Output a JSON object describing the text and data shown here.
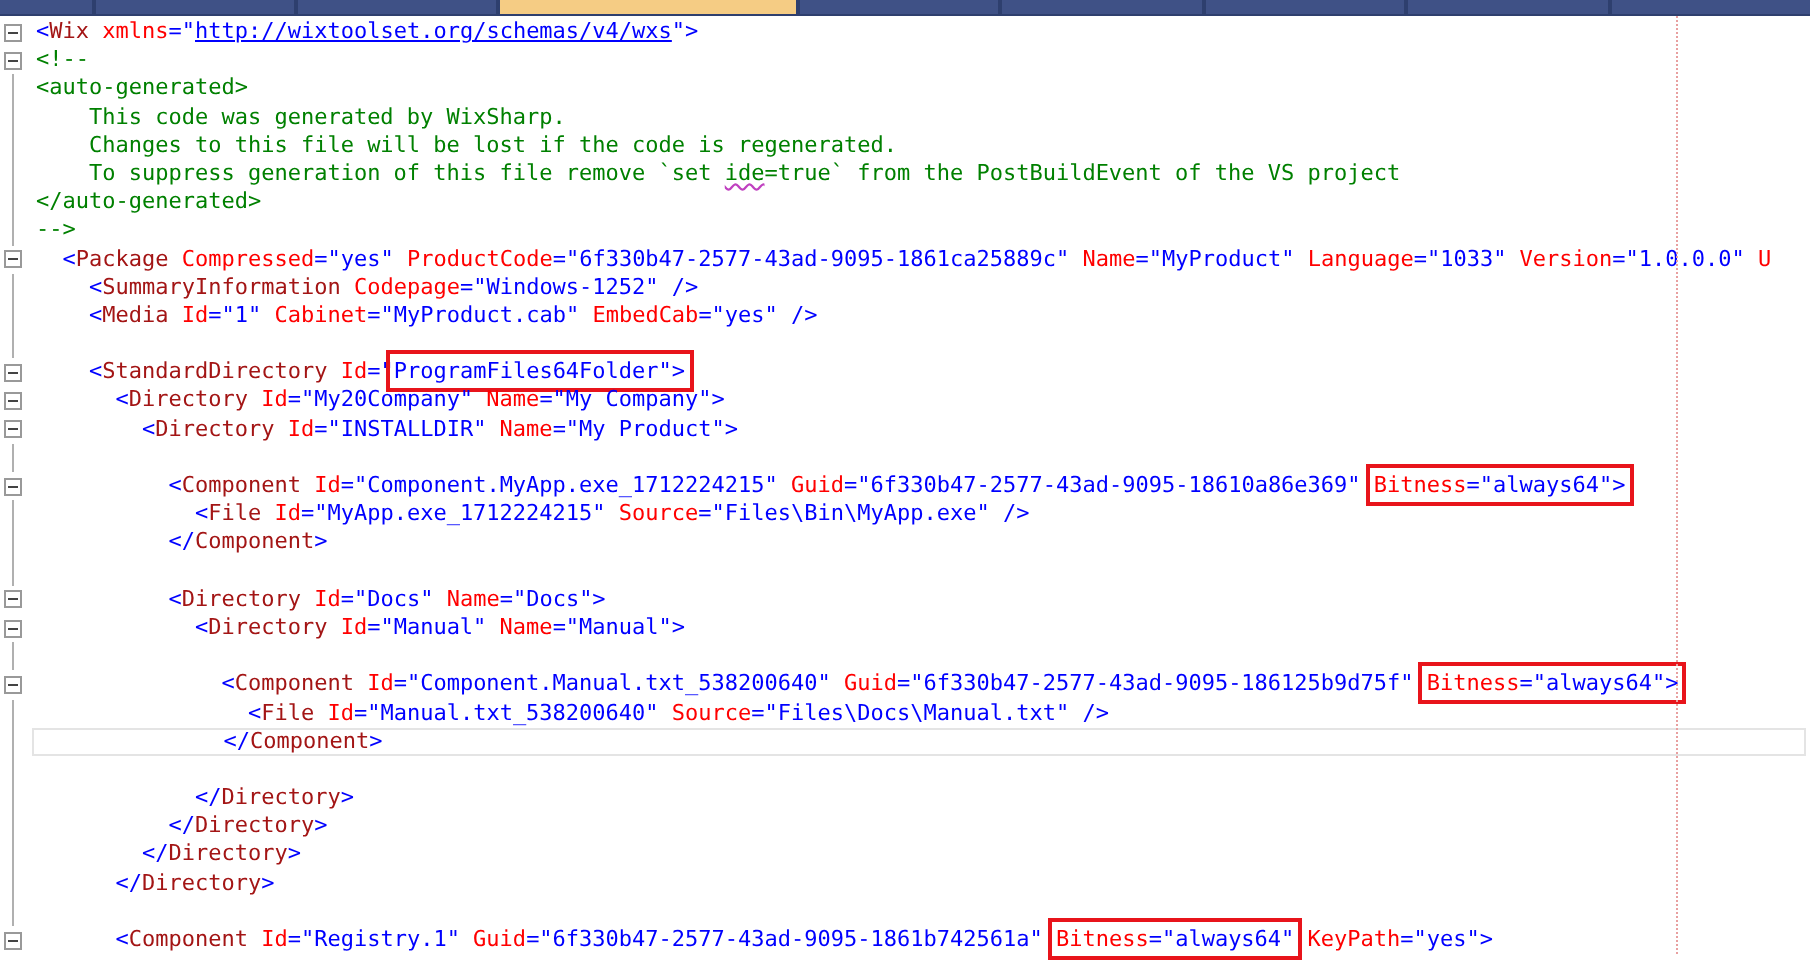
{
  "tabs": [
    {
      "selected": false
    },
    {
      "selected": false
    },
    {
      "selected": false
    },
    {
      "selected": true
    },
    {
      "selected": false
    },
    {
      "selected": false
    },
    {
      "selected": false
    },
    {
      "selected": false
    },
    {
      "selected": false
    }
  ],
  "lines": [
    {
      "fold": true,
      "current": false,
      "parts": [
        {
          "boxed": false,
          "tokens": [
            {
              "kind": "punct",
              "text": "<"
            },
            {
              "kind": "tag",
              "text": "Wix"
            },
            {
              "kind": "attr",
              "text": " xmlns"
            },
            {
              "kind": "punct",
              "text": "=\""
            },
            {
              "kind": "link",
              "text": "http://wixtoolset.org/schemas/v4/wxs"
            },
            {
              "kind": "punct",
              "text": "\">"
            }
          ]
        }
      ]
    },
    {
      "fold": true,
      "current": false,
      "parts": [
        {
          "boxed": false,
          "tokens": [
            {
              "kind": "comment",
              "text": "<!--"
            }
          ]
        }
      ]
    },
    {
      "fold": false,
      "current": false,
      "parts": [
        {
          "boxed": false,
          "tokens": [
            {
              "kind": "comment",
              "text": "<auto-generated>"
            }
          ]
        }
      ]
    },
    {
      "fold": false,
      "current": false,
      "parts": [
        {
          "boxed": false,
          "tokens": [
            {
              "kind": "comment",
              "text": "    This code was generated by WixSharp."
            }
          ]
        }
      ]
    },
    {
      "fold": false,
      "current": false,
      "parts": [
        {
          "boxed": false,
          "tokens": [
            {
              "kind": "comment",
              "text": "    Changes to this file will be lost if the code is regenerated."
            }
          ]
        }
      ]
    },
    {
      "fold": false,
      "current": false,
      "parts": [
        {
          "boxed": false,
          "tokens": [
            {
              "kind": "comment",
              "text": "    To suppress generation of this file remove `set "
            },
            {
              "kind": "misspelled",
              "text": "ide"
            },
            {
              "kind": "comment",
              "text": "=true` from the PostBuildEvent of the VS project"
            }
          ]
        }
      ]
    },
    {
      "fold": false,
      "current": false,
      "parts": [
        {
          "boxed": false,
          "tokens": [
            {
              "kind": "comment",
              "text": "</auto-generated>"
            }
          ]
        }
      ]
    },
    {
      "fold": false,
      "current": false,
      "parts": [
        {
          "boxed": false,
          "tokens": [
            {
              "kind": "comment",
              "text": "-->"
            }
          ]
        }
      ]
    },
    {
      "fold": true,
      "current": false,
      "parts": [
        {
          "boxed": false,
          "tokens": [
            {
              "kind": "punct",
              "text": "  <"
            },
            {
              "kind": "tag",
              "text": "Package"
            },
            {
              "kind": "attr",
              "text": " Compressed"
            },
            {
              "kind": "punct",
              "text": "=\"yes\""
            },
            {
              "kind": "attr",
              "text": " ProductCode"
            },
            {
              "kind": "punct",
              "text": "=\"6f330b47-2577-43ad-9095-1861ca25889c\""
            },
            {
              "kind": "attr",
              "text": " Name"
            },
            {
              "kind": "punct",
              "text": "=\"MyProduct\""
            },
            {
              "kind": "attr",
              "text": " Language"
            },
            {
              "kind": "punct",
              "text": "=\"1033\""
            },
            {
              "kind": "attr",
              "text": " Version"
            },
            {
              "kind": "punct",
              "text": "=\"1.0.0.0\""
            },
            {
              "kind": "attr",
              "text": " U"
            }
          ]
        }
      ]
    },
    {
      "fold": false,
      "current": false,
      "parts": [
        {
          "boxed": false,
          "tokens": [
            {
              "kind": "punct",
              "text": "    <"
            },
            {
              "kind": "tag",
              "text": "SummaryInformation"
            },
            {
              "kind": "attr",
              "text": " Codepage"
            },
            {
              "kind": "punct",
              "text": "=\"Windows-1252\" />"
            }
          ]
        }
      ]
    },
    {
      "fold": false,
      "current": false,
      "parts": [
        {
          "boxed": false,
          "tokens": [
            {
              "kind": "punct",
              "text": "    <"
            },
            {
              "kind": "tag",
              "text": "Media"
            },
            {
              "kind": "attr",
              "text": " Id"
            },
            {
              "kind": "punct",
              "text": "=\"1\""
            },
            {
              "kind": "attr",
              "text": " Cabinet"
            },
            {
              "kind": "punct",
              "text": "=\"MyProduct.cab\""
            },
            {
              "kind": "attr",
              "text": " EmbedCab"
            },
            {
              "kind": "punct",
              "text": "=\"yes\" />"
            }
          ]
        }
      ]
    },
    {
      "fold": false,
      "current": false
    },
    {
      "fold": true,
      "current": false,
      "parts": [
        {
          "boxed": false,
          "tokens": [
            {
              "kind": "punct",
              "text": "    <"
            },
            {
              "kind": "tag",
              "text": "StandardDirectory"
            },
            {
              "kind": "attr",
              "text": " Id"
            },
            {
              "kind": "punct",
              "text": "=\""
            }
          ]
        },
        {
          "boxed": true,
          "tokens": [
            {
              "kind": "punct",
              "text": "ProgramFiles64Folder\">"
            }
          ]
        }
      ]
    },
    {
      "fold": true,
      "current": false,
      "parts": [
        {
          "boxed": false,
          "tokens": [
            {
              "kind": "punct",
              "text": "      <"
            },
            {
              "kind": "tag",
              "text": "Directory"
            },
            {
              "kind": "attr",
              "text": " Id"
            },
            {
              "kind": "punct",
              "text": "=\"My20Company\""
            },
            {
              "kind": "attr",
              "text": " Name"
            },
            {
              "kind": "punct",
              "text": "=\"My Company\">"
            }
          ]
        }
      ]
    },
    {
      "fold": true,
      "current": false,
      "parts": [
        {
          "boxed": false,
          "tokens": [
            {
              "kind": "punct",
              "text": "        <"
            },
            {
              "kind": "tag",
              "text": "Directory"
            },
            {
              "kind": "attr",
              "text": " Id"
            },
            {
              "kind": "punct",
              "text": "=\"INSTALLDIR\""
            },
            {
              "kind": "attr",
              "text": " Name"
            },
            {
              "kind": "punct",
              "text": "=\"My Product\">"
            }
          ]
        }
      ]
    },
    {
      "fold": false,
      "current": false
    },
    {
      "fold": true,
      "current": false,
      "parts": [
        {
          "boxed": false,
          "tokens": [
            {
              "kind": "punct",
              "text": "          <"
            },
            {
              "kind": "tag",
              "text": "Component"
            },
            {
              "kind": "attr",
              "text": " Id"
            },
            {
              "kind": "punct",
              "text": "=\"Component.MyApp.exe_1712224215\""
            },
            {
              "kind": "attr",
              "text": " Guid"
            },
            {
              "kind": "punct",
              "text": "=\"6f330b47-2577-43ad-9095-18610a86e369\" "
            }
          ]
        },
        {
          "boxed": true,
          "tokens": [
            {
              "kind": "attr",
              "text": "Bitness"
            },
            {
              "kind": "punct",
              "text": "=\"always64\">"
            }
          ]
        }
      ]
    },
    {
      "fold": false,
      "current": false,
      "parts": [
        {
          "boxed": false,
          "tokens": [
            {
              "kind": "punct",
              "text": "            <"
            },
            {
              "kind": "tag",
              "text": "File"
            },
            {
              "kind": "attr",
              "text": " Id"
            },
            {
              "kind": "punct",
              "text": "=\"MyApp.exe_1712224215\""
            },
            {
              "kind": "attr",
              "text": " Source"
            },
            {
              "kind": "punct",
              "text": "=\"Files\\Bin\\MyApp.exe\" />"
            }
          ]
        }
      ]
    },
    {
      "fold": false,
      "current": false,
      "parts": [
        {
          "boxed": false,
          "tokens": [
            {
              "kind": "punct",
              "text": "          </"
            },
            {
              "kind": "tag",
              "text": "Component"
            },
            {
              "kind": "punct",
              "text": ">"
            }
          ]
        }
      ]
    },
    {
      "fold": false,
      "current": false
    },
    {
      "fold": true,
      "current": false,
      "parts": [
        {
          "boxed": false,
          "tokens": [
            {
              "kind": "punct",
              "text": "          <"
            },
            {
              "kind": "tag",
              "text": "Directory"
            },
            {
              "kind": "attr",
              "text": " Id"
            },
            {
              "kind": "punct",
              "text": "=\"Docs\""
            },
            {
              "kind": "attr",
              "text": " Name"
            },
            {
              "kind": "punct",
              "text": "=\"Docs\">"
            }
          ]
        }
      ]
    },
    {
      "fold": true,
      "current": false,
      "parts": [
        {
          "boxed": false,
          "tokens": [
            {
              "kind": "punct",
              "text": "            <"
            },
            {
              "kind": "tag",
              "text": "Directory"
            },
            {
              "kind": "attr",
              "text": " Id"
            },
            {
              "kind": "punct",
              "text": "=\"Manual\""
            },
            {
              "kind": "attr",
              "text": " Name"
            },
            {
              "kind": "punct",
              "text": "=\"Manual\">"
            }
          ]
        }
      ]
    },
    {
      "fold": false,
      "current": false
    },
    {
      "fold": true,
      "current": false,
      "parts": [
        {
          "boxed": false,
          "tokens": [
            {
              "kind": "punct",
              "text": "              <"
            },
            {
              "kind": "tag",
              "text": "Component"
            },
            {
              "kind": "attr",
              "text": " Id"
            },
            {
              "kind": "punct",
              "text": "=\"Component.Manual.txt_538200640\""
            },
            {
              "kind": "attr",
              "text": " Guid"
            },
            {
              "kind": "punct",
              "text": "=\"6f330b47-2577-43ad-9095-186125b9d75f\" "
            }
          ]
        },
        {
          "boxed": true,
          "tokens": [
            {
              "kind": "attr",
              "text": "Bitness"
            },
            {
              "kind": "punct",
              "text": "=\"always64\">"
            }
          ]
        }
      ]
    },
    {
      "fold": false,
      "current": false,
      "parts": [
        {
          "boxed": false,
          "tokens": [
            {
              "kind": "punct",
              "text": "                <"
            },
            {
              "kind": "tag",
              "text": "File"
            },
            {
              "kind": "attr",
              "text": " Id"
            },
            {
              "kind": "punct",
              "text": "=\"Manual.txt_538200640\""
            },
            {
              "kind": "attr",
              "text": " Source"
            },
            {
              "kind": "punct",
              "text": "=\"Files\\Docs\\Manual.txt\" />"
            }
          ]
        }
      ]
    },
    {
      "fold": false,
      "current": true,
      "parts": [
        {
          "boxed": false,
          "tokens": [
            {
              "kind": "punct",
              "text": "              </"
            },
            {
              "kind": "tag",
              "text": "Component"
            },
            {
              "kind": "punct",
              "text": ">"
            }
          ]
        }
      ]
    },
    {
      "fold": false,
      "current": false
    },
    {
      "fold": false,
      "current": false,
      "parts": [
        {
          "boxed": false,
          "tokens": [
            {
              "kind": "punct",
              "text": "            </"
            },
            {
              "kind": "tag",
              "text": "Directory"
            },
            {
              "kind": "punct",
              "text": ">"
            }
          ]
        }
      ]
    },
    {
      "fold": false,
      "current": false,
      "parts": [
        {
          "boxed": false,
          "tokens": [
            {
              "kind": "punct",
              "text": "          </"
            },
            {
              "kind": "tag",
              "text": "Directory"
            },
            {
              "kind": "punct",
              "text": ">"
            }
          ]
        }
      ]
    },
    {
      "fold": false,
      "current": false,
      "parts": [
        {
          "boxed": false,
          "tokens": [
            {
              "kind": "punct",
              "text": "        </"
            },
            {
              "kind": "tag",
              "text": "Directory"
            },
            {
              "kind": "punct",
              "text": ">"
            }
          ]
        }
      ]
    },
    {
      "fold": false,
      "current": false,
      "parts": [
        {
          "boxed": false,
          "tokens": [
            {
              "kind": "punct",
              "text": "      </"
            },
            {
              "kind": "tag",
              "text": "Directory"
            },
            {
              "kind": "punct",
              "text": ">"
            }
          ]
        }
      ]
    },
    {
      "fold": false,
      "current": false
    },
    {
      "fold": true,
      "current": false,
      "parts": [
        {
          "boxed": false,
          "tokens": [
            {
              "kind": "punct",
              "text": "      <"
            },
            {
              "kind": "tag",
              "text": "Component"
            },
            {
              "kind": "attr",
              "text": " Id"
            },
            {
              "kind": "punct",
              "text": "=\"Registry.1\""
            },
            {
              "kind": "attr",
              "text": " Guid"
            },
            {
              "kind": "punct",
              "text": "=\"6f330b47-2577-43ad-9095-1861b742561a\" "
            }
          ]
        },
        {
          "boxed": true,
          "tokens": [
            {
              "kind": "attr",
              "text": "Bitness"
            },
            {
              "kind": "punct",
              "text": "=\"always64\""
            }
          ]
        },
        {
          "boxed": false,
          "tokens": [
            {
              "kind": "attr",
              "text": " KeyPath"
            },
            {
              "kind": "punct",
              "text": "=\"yes\">"
            }
          ]
        }
      ]
    }
  ]
}
